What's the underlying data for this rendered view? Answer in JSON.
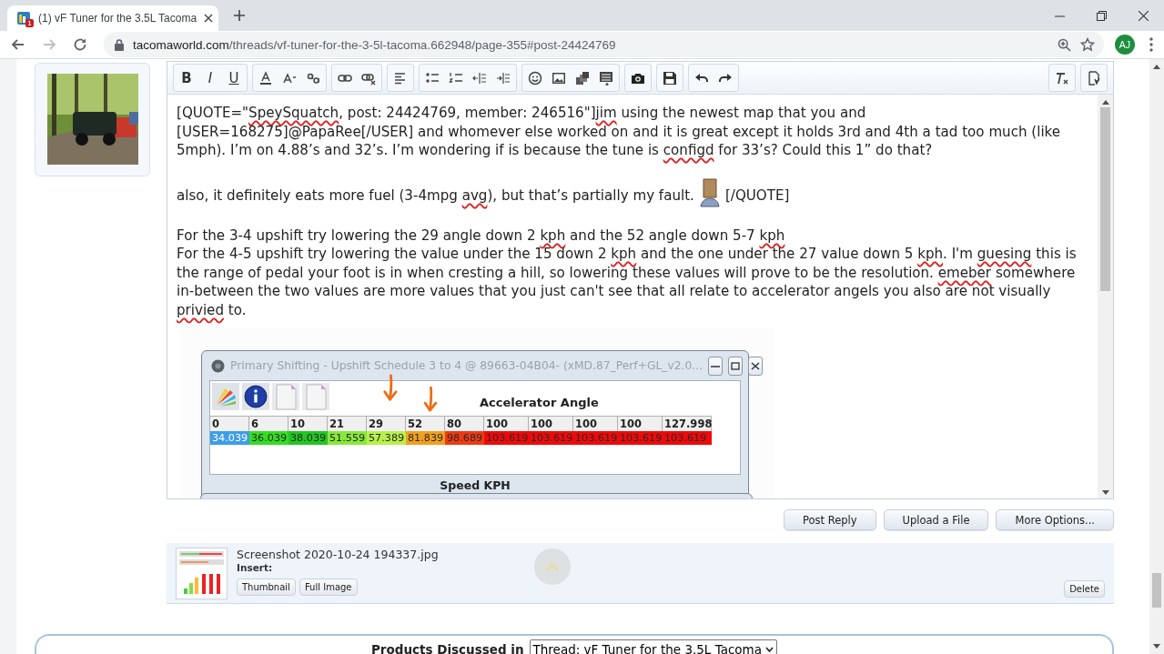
{
  "browser": {
    "tab": {
      "title": "(1) vF Tuner for the 3.5L Tacoma",
      "favicon_badge": "1"
    },
    "forward_disabled": true,
    "url": {
      "domain": "tacomaworld.com",
      "path": "/threads/vf-tuner-for-the-3-5l-tacoma.662948/page-355#post-24424769"
    },
    "profile": "AJ"
  },
  "editor": {
    "format_buttons": [
      "B",
      "I",
      "U"
    ],
    "quote": [
      [
        {
          "text": "[QUOTE=\"",
          "misspelled": false
        },
        {
          "text": "SpeySquatch",
          "misspelled": true
        },
        {
          "text": ", post: 24424769, member: 246516\"]",
          "misspelled": false
        },
        {
          "text": "jim",
          "misspelled": true
        },
        {
          "text": " using the newest map that you and [USER=168275]@PapaRee[/USER] and whomever else worked on and it is great except it holds 3rd and 4th a tad too much (like 5mph). I’m on 4.88’s and 32’s. I’m wondering if is because the tune is ",
          "misspelled": false
        },
        {
          "text": "configd",
          "misspelled": true
        },
        {
          "text": " for 33’s? Could this 1” do that?",
          "misspelled": false
        }
      ],
      [
        {
          "text": "also, it definitely eats more fuel (3-4mpg ",
          "misspelled": false
        },
        {
          "text": "avg",
          "misspelled": true
        },
        {
          "text": "), but that’s partially my fault.",
          "misspelled": false
        },
        {
          "kind": "smilie"
        },
        {
          "text": "[/QUOTE]",
          "misspelled": false
        }
      ]
    ],
    "reply": [
      [
        {
          "text": "For the 3-4 upshift try lowering the 29 angle down 2 ",
          "misspelled": false
        },
        {
          "text": "kph",
          "misspelled": true
        },
        {
          "text": " and the 52 angle down 5-7 ",
          "misspelled": false
        },
        {
          "text": "kph",
          "misspelled": true
        }
      ],
      [
        {
          "text": "For the 4-5 upshift try lowering the value under the 15 down 2 ",
          "misspelled": false
        },
        {
          "text": "kph",
          "misspelled": true
        },
        {
          "text": " and the one under the 27 value down 5 ",
          "misspelled": false
        },
        {
          "text": "kph",
          "misspelled": true
        },
        {
          "text": ". I'm ",
          "misspelled": false
        },
        {
          "text": "guesing",
          "misspelled": true
        },
        {
          "text": " this is the range of pedal your foot is in when cresting a hill, so lowering these values will prove to be the resolution. ",
          "misspelled": false
        },
        {
          "text": "emeber",
          "misspelled": true
        },
        {
          "text": " somewhere in-between the two values are more values that you just can't see that all relate to accelerator angels you also are not visually ",
          "misspelled": false
        },
        {
          "text": "privied",
          "misspelled": true
        },
        {
          "text": " to.",
          "misspelled": false
        }
      ]
    ],
    "embedded_screenshot": {
      "window_title": "Primary Shifting - Upshift Schedule 3 to 4 @ 89663-04B04- (xMD.87_Perf+GL_v2.0...",
      "column_axis": "Accelerator Angle",
      "headers": [
        "0",
        "6",
        "10",
        "21",
        "29",
        "52",
        "80",
        "100",
        "100",
        "100",
        "100",
        "127.998"
      ],
      "values": [
        {
          "text": "34.039",
          "color": "#3d9de8"
        },
        {
          "text": "36.039",
          "color": "#33dd22"
        },
        {
          "text": "38.039",
          "color": "#22c622"
        },
        {
          "text": "51.559",
          "color": "#88e83a"
        },
        {
          "text": "57.389",
          "color": "#b8f04a"
        },
        {
          "text": "81.839",
          "color": "#f0a01e"
        },
        {
          "text": "98.689",
          "color": "#ee3a12"
        },
        {
          "text": "103.619",
          "color": "#ee0a0a"
        },
        {
          "text": "103.619",
          "color": "#ee0a0a"
        },
        {
          "text": "103.619",
          "color": "#ee0a0a"
        },
        {
          "text": "103.619",
          "color": "#ee0a0a"
        },
        {
          "text": "103.619",
          "color": "#ee0a0a"
        }
      ],
      "row_axis": "Speed KPH"
    }
  },
  "actions": [
    "Post Reply",
    "Upload a File",
    "More Options..."
  ],
  "attachment": {
    "filename": "Screenshot 2020-10-24 194337.jpg",
    "insert_label": "Insert:",
    "insert_buttons": [
      "Thumbnail",
      "Full Image"
    ],
    "delete": "Delete"
  },
  "products": {
    "label": "Products Discussed in",
    "select": "Thread: vF Tuner for the 3.5L Tacoma"
  }
}
